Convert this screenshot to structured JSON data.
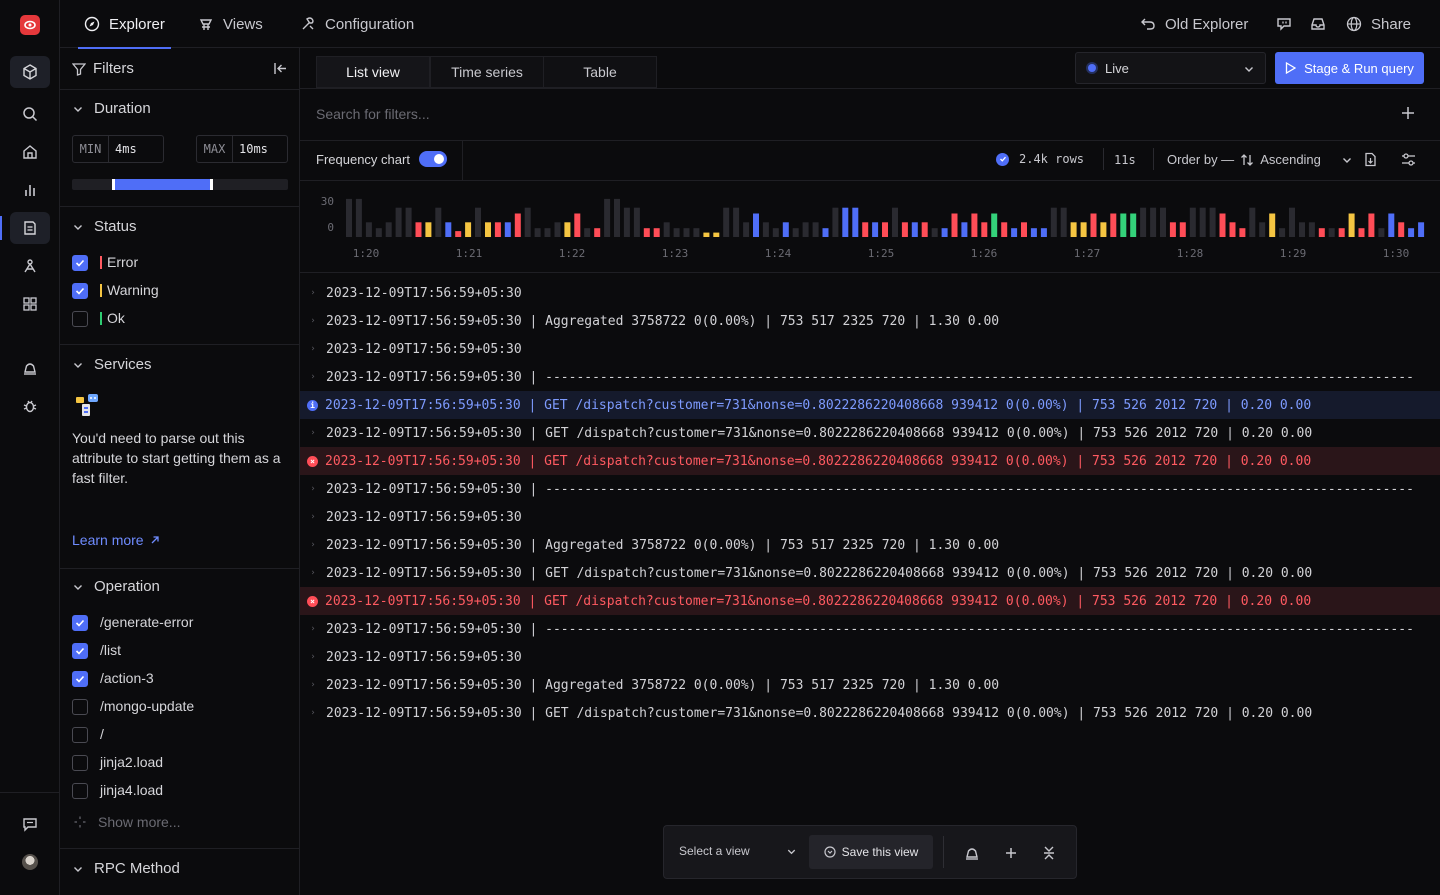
{
  "topbar": {
    "tabs": [
      {
        "label": "Explorer",
        "icon": "compass-icon"
      },
      {
        "label": "Views",
        "icon": "views-icon"
      },
      {
        "label": "Configuration",
        "icon": "configuration-icon"
      }
    ],
    "old_explorer": "Old Explorer",
    "share": "Share"
  },
  "sidebar": {
    "filters_title": "Filters",
    "duration": {
      "title": "Duration",
      "min_label": "MIN",
      "min_value": "4ms",
      "max_label": "MAX",
      "max_value": "10ms",
      "range_start_fraction": 0.19,
      "range_end_fraction": 0.65
    },
    "status": {
      "title": "Status",
      "items": [
        {
          "label": "Error",
          "checked": true,
          "color": "#ff5a61"
        },
        {
          "label": "Warning",
          "checked": true,
          "color": "#f5c542"
        },
        {
          "label": "Ok",
          "checked": false,
          "color": "#2ecc71"
        }
      ]
    },
    "services": {
      "title": "Services",
      "message": "You'd need to parse out this attribute to start getting them as a fast filter.",
      "learn_more": "Learn more"
    },
    "operation": {
      "title": "Operation",
      "items": [
        {
          "label": "/generate-error",
          "checked": true
        },
        {
          "label": "/list",
          "checked": true
        },
        {
          "label": "/action-3",
          "checked": true
        },
        {
          "label": "/mongo-update",
          "checked": false
        },
        {
          "label": "/",
          "checked": false
        },
        {
          "label": "jinja2.load",
          "checked": false
        },
        {
          "label": "jinja4.load",
          "checked": false
        }
      ],
      "show_more": "Show more..."
    },
    "rpc_method": {
      "title": "RPC Method"
    }
  },
  "main": {
    "view_tabs": [
      "List view",
      "Time series",
      "Table"
    ],
    "live_label": "Live",
    "run_button": "Stage & Run query",
    "search_placeholder": "Search for filters...",
    "frequency_chart_label": "Frequency chart",
    "frequency_chart_on": true,
    "rows": "2.4k rows",
    "duration": "11s",
    "order_by_label": "Order by —",
    "order_value": "Ascending"
  },
  "chart_data": {
    "type": "bar",
    "y_ticks": [
      "30",
      "0"
    ],
    "x_ticks": [
      "1:20",
      "1:21",
      "1:22",
      "1:23",
      "1:24",
      "1:25",
      "1:26",
      "1:27",
      "1:28",
      "1:29",
      "1:30"
    ],
    "colors": {
      "ok": "#2a2a30",
      "error": "#ff4d57",
      "warning": "#f5c542",
      "info": "#4f6ef7",
      "success": "#34d27a"
    },
    "ylim": [
      0,
      30
    ],
    "bars": [
      "g:26",
      "g:26",
      "g:10",
      "g:6",
      "g:10",
      "g:20",
      "g:20",
      "r:10",
      "y:10",
      "g:20",
      "b:10",
      "r:4",
      "y:10",
      "g:20",
      "y:10",
      "r:10",
      "b:10",
      "r:16",
      "g:20",
      "g:6",
      "g:6",
      "g:10",
      "y:10",
      "r:16",
      "g:6",
      "r:6",
      "g:26",
      "g:26",
      "g:20",
      "g:20",
      "r:6",
      "r:6",
      "g:10",
      "g:6",
      "g:6",
      "g:6",
      "y:3",
      "y:3",
      "g:20",
      "g:20",
      "g:10",
      "b:16",
      "g:10",
      "g:6",
      "b:10",
      "g:6",
      "g:10",
      "g:10",
      "b:6",
      "g:20",
      "b:20",
      "b:20",
      "r:10",
      "b:10",
      "r:10",
      "g:20",
      "r:10",
      "b:10",
      "r:10",
      "g:6",
      "b:6",
      "r:16",
      "b:10",
      "r:16",
      "r:10",
      "s:16",
      "r:10",
      "b:6",
      "r:10",
      "b:6",
      "b:6",
      "g:20",
      "g:20",
      "y:10",
      "y:10",
      "r:16",
      "y:10",
      "r:16",
      "s:16",
      "s:16",
      "g:20",
      "g:20",
      "g:20",
      "r:10",
      "r:10",
      "g:20",
      "g:20",
      "g:20",
      "r:16",
      "r:10",
      "r:6",
      "g:20",
      "g:10",
      "y:16",
      "g:6",
      "g:20",
      "g:10",
      "g:10",
      "r:6",
      "g:6",
      "r:6",
      "y:16",
      "r:6",
      "r:16",
      "g:6",
      "b:16",
      "r:10",
      "b:6",
      "b:10"
    ]
  },
  "logs": [
    {
      "kind": "normal",
      "text": "2023-12-09T17:56:59+05:30"
    },
    {
      "kind": "normal",
      "text": "2023-12-09T17:56:59+05:30 | Aggregated 3758722 0(0.00%) | 753 517 2325 720 | 1.30 0.00"
    },
    {
      "kind": "normal",
      "text": "2023-12-09T17:56:59+05:30"
    },
    {
      "kind": "normal",
      "text": "2023-12-09T17:56:59+05:30 | ------------------------------------------------------------------------------------------------------------------------"
    },
    {
      "kind": "info",
      "text": "2023-12-09T17:56:59+05:30 | GET /dispatch?customer=731&nonse=0.8022286220408668 939412 0(0.00%) | 753 526 2012 720 | 0.20 0.00"
    },
    {
      "kind": "normal",
      "text": "2023-12-09T17:56:59+05:30 | GET /dispatch?customer=731&nonse=0.8022286220408668 939412 0(0.00%) | 753 526 2012 720 | 0.20 0.00"
    },
    {
      "kind": "err",
      "text": "2023-12-09T17:56:59+05:30 | GET /dispatch?customer=731&nonse=0.8022286220408668 939412 0(0.00%) | 753 526 2012 720 | 0.20 0.00"
    },
    {
      "kind": "normal",
      "text": "2023-12-09T17:56:59+05:30 | ------------------------------------------------------------------------------------------------------------------------"
    },
    {
      "kind": "normal",
      "text": "2023-12-09T17:56:59+05:30"
    },
    {
      "kind": "normal",
      "text": "2023-12-09T17:56:59+05:30 | Aggregated 3758722 0(0.00%) | 753 517 2325 720 | 1.30 0.00"
    },
    {
      "kind": "normal",
      "text": "2023-12-09T17:56:59+05:30 | GET /dispatch?customer=731&nonse=0.8022286220408668 939412 0(0.00%) | 753 526 2012 720 | 0.20 0.00"
    },
    {
      "kind": "err",
      "text": "2023-12-09T17:56:59+05:30 | GET /dispatch?customer=731&nonse=0.8022286220408668 939412 0(0.00%) | 753 526 2012 720 | 0.20 0.00"
    },
    {
      "kind": "normal",
      "text": "2023-12-09T17:56:59+05:30 | ------------------------------------------------------------------------------------------------------------------------"
    },
    {
      "kind": "normal",
      "text": "2023-12-09T17:56:59+05:30"
    },
    {
      "kind": "normal",
      "text": "2023-12-09T17:56:59+05:30 | Aggregated 3758722 0(0.00%) | 753 517 2325 720 | 1.30 0.00"
    },
    {
      "kind": "normal",
      "text": "2023-12-09T17:56:59+05:30 | GET /dispatch?customer=731&nonse=0.8022286220408668 939412 0(0.00%) | 753 526 2012 720 | 0.20 0.00"
    }
  ],
  "bottom_bar": {
    "select_view": "Select a view",
    "save_view": "Save this view"
  }
}
